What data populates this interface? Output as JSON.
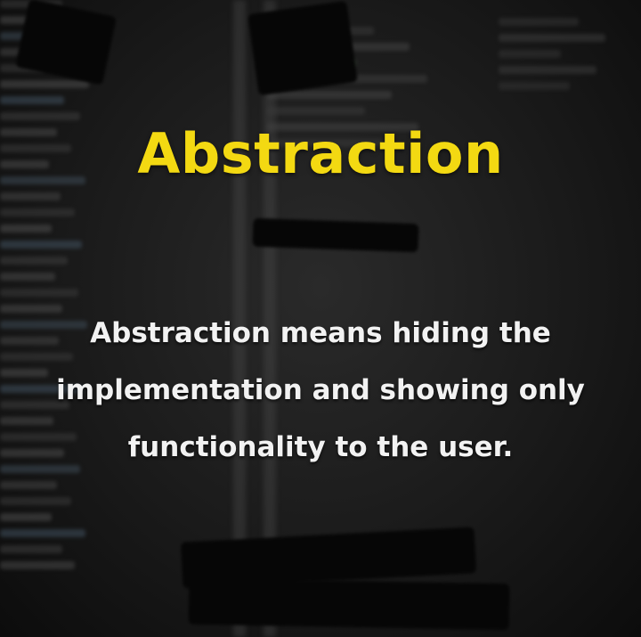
{
  "title": "Abstraction",
  "body_lines": [
    "Abstraction means hiding the",
    "implementation and showing only",
    "functionality to the user."
  ],
  "colors": {
    "title": "#f3d912",
    "body": "#f2f2f2",
    "background": "#151515"
  }
}
